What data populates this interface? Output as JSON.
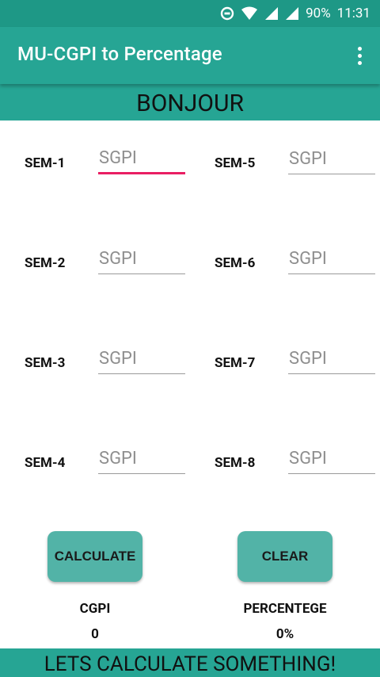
{
  "status_bar": {
    "battery": "90%",
    "time": "11:31",
    "icons": [
      "data-saver-icon",
      "wifi-icon",
      "signal-icon",
      "signal-icon-2"
    ]
  },
  "app_bar": {
    "title": "MU-CGPI to Percentage",
    "menu_icon": "more-vert-icon"
  },
  "banner": {
    "text": "BONJOUR"
  },
  "semesters": {
    "left": [
      {
        "label": "SEM-1",
        "placeholder": "SGPI",
        "value": ""
      },
      {
        "label": "SEM-2",
        "placeholder": "SGPI",
        "value": ""
      },
      {
        "label": "SEM-3",
        "placeholder": "SGPI",
        "value": ""
      },
      {
        "label": "SEM-4",
        "placeholder": "SGPI",
        "value": ""
      }
    ],
    "right": [
      {
        "label": "SEM-5",
        "placeholder": "SGPI",
        "value": ""
      },
      {
        "label": "SEM-6",
        "placeholder": "SGPI",
        "value": ""
      },
      {
        "label": "SEM-7",
        "placeholder": "SGPI",
        "value": ""
      },
      {
        "label": "SEM-8",
        "placeholder": "SGPI",
        "value": ""
      }
    ]
  },
  "buttons": {
    "calculate": "CALCULATE",
    "clear": "CLEAR"
  },
  "results": {
    "cgpi_label": "CGPI",
    "cgpi_value": "0",
    "percentage_label": "PERCENTEGE",
    "percentage_value": "0%"
  },
  "footer": {
    "text": "LETS CALCULATE SOMETHING!"
  },
  "colors": {
    "primary": "#26a594",
    "primary_dark": "#1e9886",
    "button": "#52b3a7",
    "focus_underline": "#e91e63"
  }
}
